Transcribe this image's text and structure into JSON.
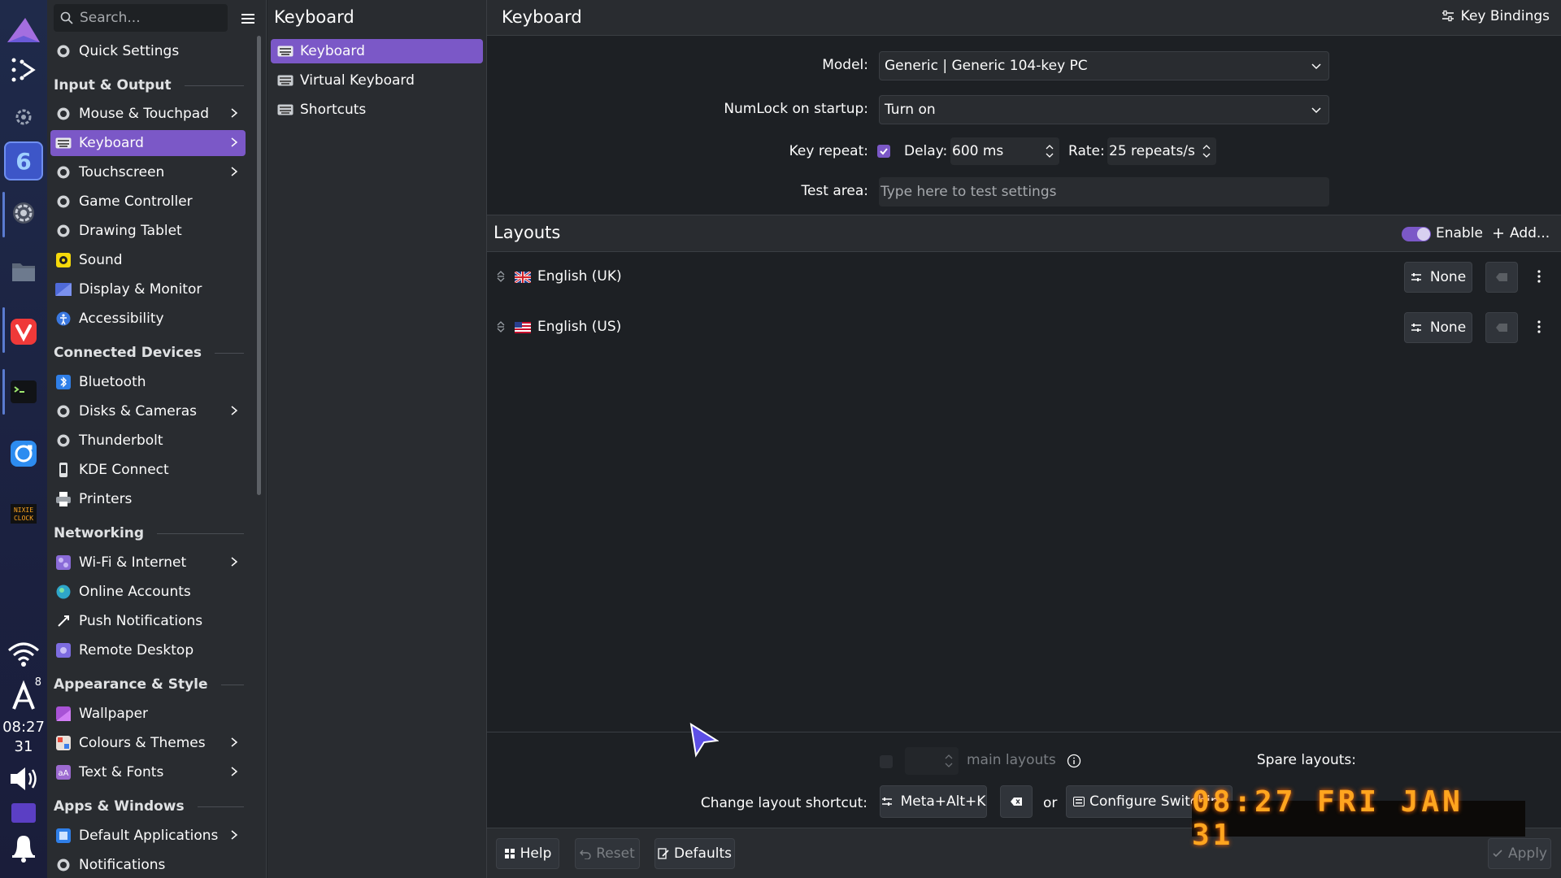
{
  "dock": {
    "clock_time": "08:27",
    "clock_day": "31",
    "notification_count": "8",
    "app6_label": "6",
    "nixie_icon_text": "NIXIE CLOCK"
  },
  "sidebar": {
    "search_placeholder": "Search...",
    "items": [
      {
        "label": "Quick Settings"
      },
      {
        "header": "Input & Output"
      },
      {
        "label": "Mouse & Touchpad"
      },
      {
        "label": "Keyboard"
      },
      {
        "label": "Touchscreen"
      },
      {
        "label": "Game Controller"
      },
      {
        "label": "Drawing Tablet"
      },
      {
        "label": "Sound"
      },
      {
        "label": "Display & Monitor"
      },
      {
        "label": "Accessibility"
      },
      {
        "header": "Connected Devices"
      },
      {
        "label": "Bluetooth"
      },
      {
        "label": "Disks & Cameras"
      },
      {
        "label": "Thunderbolt"
      },
      {
        "label": "KDE Connect"
      },
      {
        "label": "Printers"
      },
      {
        "header": "Networking"
      },
      {
        "label": "Wi-Fi & Internet"
      },
      {
        "label": "Online Accounts"
      },
      {
        "label": "Push Notifications"
      },
      {
        "label": "Remote Desktop"
      },
      {
        "header": "Appearance & Style"
      },
      {
        "label": "Wallpaper"
      },
      {
        "label": "Colours & Themes"
      },
      {
        "label": "Text & Fonts"
      },
      {
        "header": "Apps & Windows"
      },
      {
        "label": "Default Applications"
      },
      {
        "label": "Notifications"
      }
    ]
  },
  "subpanel": {
    "title": "Keyboard",
    "items": [
      {
        "label": "Keyboard"
      },
      {
        "label": "Virtual Keyboard"
      },
      {
        "label": "Shortcuts"
      }
    ]
  },
  "main": {
    "title": "Keyboard",
    "key_bindings_label": "Key Bindings",
    "model_label": "Model:",
    "model_value": "Generic | Generic 104-key PC",
    "numlock_label": "NumLock on startup:",
    "numlock_value": "Turn on",
    "key_repeat_label": "Key repeat:",
    "delay_label": "Delay:",
    "delay_value": "600 ms",
    "rate_label": "Rate:",
    "rate_value": "25 repeats/s",
    "test_area_label": "Test area:",
    "test_area_placeholder": "Type here to test settings",
    "layouts_title": "Layouts",
    "enable_label": "Enable",
    "add_label": "Add...",
    "layouts": [
      {
        "name": "English (UK)",
        "shortcut": "None"
      },
      {
        "name": "English (US)",
        "shortcut": "None"
      }
    ],
    "spare_layouts_label": "Spare layouts:",
    "main_layouts_label": "main layouts",
    "change_shortcut_label": "Change layout shortcut:",
    "shortcut_value": "Meta+Alt+K",
    "or_label": "or",
    "configure_switching_label": "Configure Switching",
    "help_label": "Help",
    "reset_label": "Reset",
    "defaults_label": "Defaults",
    "apply_label": "Apply"
  },
  "nixie_clock": "08:27 FRI JAN 31",
  "colors": {
    "accent": "#7b58c7",
    "panel": "#292c30",
    "background": "#1d2024",
    "nixie": "#ffa51f"
  }
}
